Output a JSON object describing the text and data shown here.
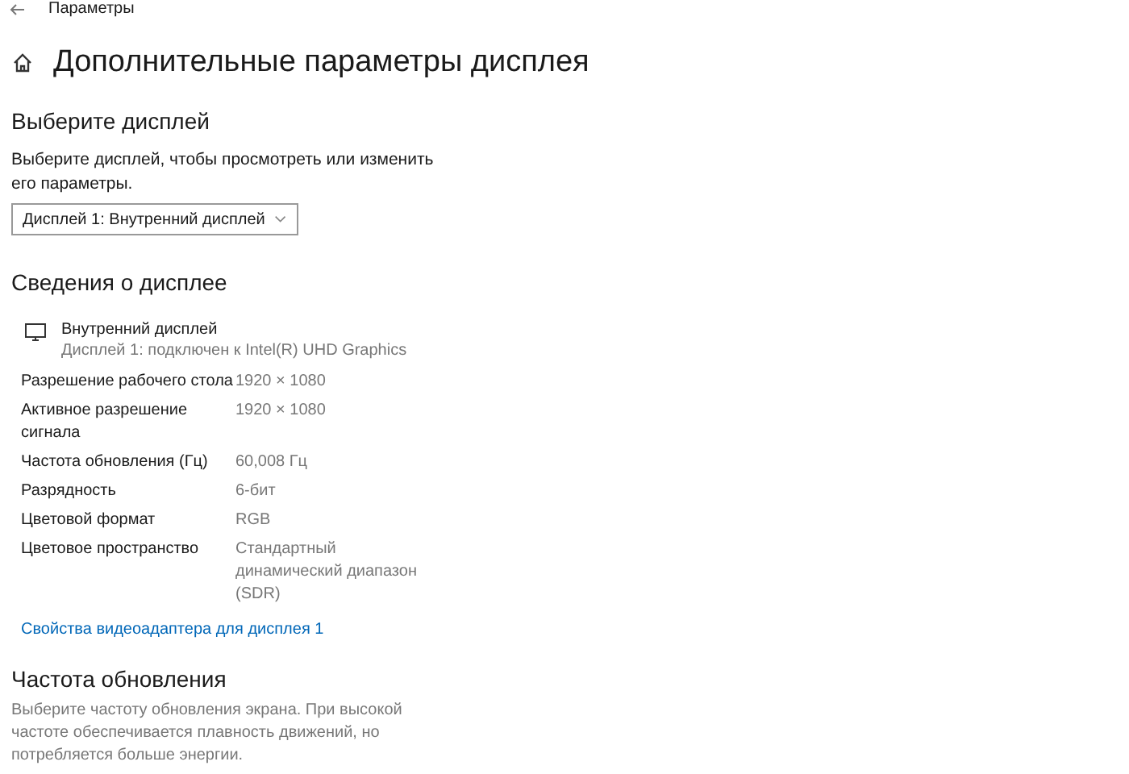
{
  "window": {
    "title": "Параметры"
  },
  "page_title": "Дополнительные параметры дисплея",
  "select_display": {
    "heading": "Выберите дисплей",
    "description": "Выберите дисплей, чтобы просмотреть или изменить его параметры.",
    "dropdown": {
      "value": "Дисплей 1: Внутренний дисплей"
    }
  },
  "display_info": {
    "heading": "Сведения о дисплее",
    "display_name": "Внутренний дисплей",
    "display_subtitle": "Дисплей 1: подключен к Intel(R) UHD Graphics",
    "rows": [
      {
        "label": "Разрешение рабочего стола",
        "value": "1920 × 1080"
      },
      {
        "label": "Активное разрешение сигнала",
        "value": "1920 × 1080"
      },
      {
        "label": "Частота обновления (Гц)",
        "value": "60,008 Гц"
      },
      {
        "label": "Разрядность",
        "value": "6-бит"
      },
      {
        "label": "Цветовой формат",
        "value": "RGB"
      },
      {
        "label": "Цветовое пространство",
        "value": "Стандартный динамический диапазон (SDR)"
      }
    ],
    "link": "Свойства видеоадаптера для дисплея 1"
  },
  "refresh_rate": {
    "heading": "Частота обновления",
    "description": "Выберите частоту обновления экрана. При высокой частоте обеспечивается плавность движений, но потребляется больше энергии."
  }
}
